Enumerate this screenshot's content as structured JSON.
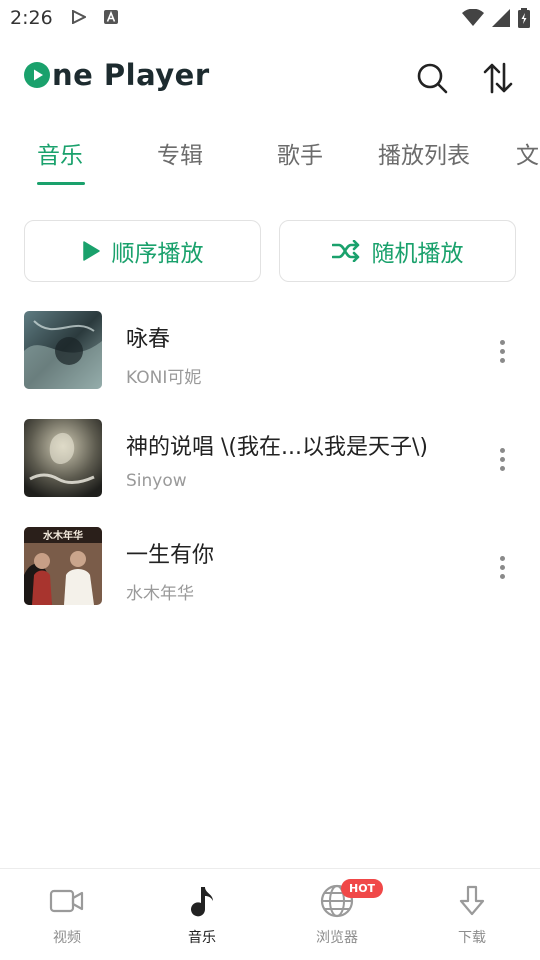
{
  "status_bar": {
    "time": "2:26"
  },
  "header": {
    "logo_text": "ne Player"
  },
  "tabs": [
    {
      "label": "音乐",
      "active": true
    },
    {
      "label": "专辑",
      "active": false
    },
    {
      "label": "歌手",
      "active": false
    },
    {
      "label": "播放列表",
      "active": false
    },
    {
      "label": "文",
      "active": false
    }
  ],
  "play_buttons": {
    "sequential_label": "顺序播放",
    "shuffle_label": "随机播放"
  },
  "songs": [
    {
      "title": "咏春",
      "artist": "KONI可妮"
    },
    {
      "title": "神的说唱 \\(我在...以我是天子\\)",
      "artist": "Sinyow"
    },
    {
      "title": "一生有你",
      "artist": "水木年华"
    }
  ],
  "covers": {
    "song3_text": "水木年华"
  },
  "bottom_nav": {
    "items": [
      {
        "label": "视频",
        "icon": "video-icon",
        "active": false
      },
      {
        "label": "音乐",
        "icon": "music-note-icon",
        "active": true
      },
      {
        "label": "浏览器",
        "icon": "globe-icon",
        "active": false,
        "badge": "HOT"
      },
      {
        "label": "下载",
        "icon": "download-icon",
        "active": false
      }
    ]
  },
  "colors": {
    "accent": "#1aa16c",
    "hot_badge": "#f04848"
  }
}
